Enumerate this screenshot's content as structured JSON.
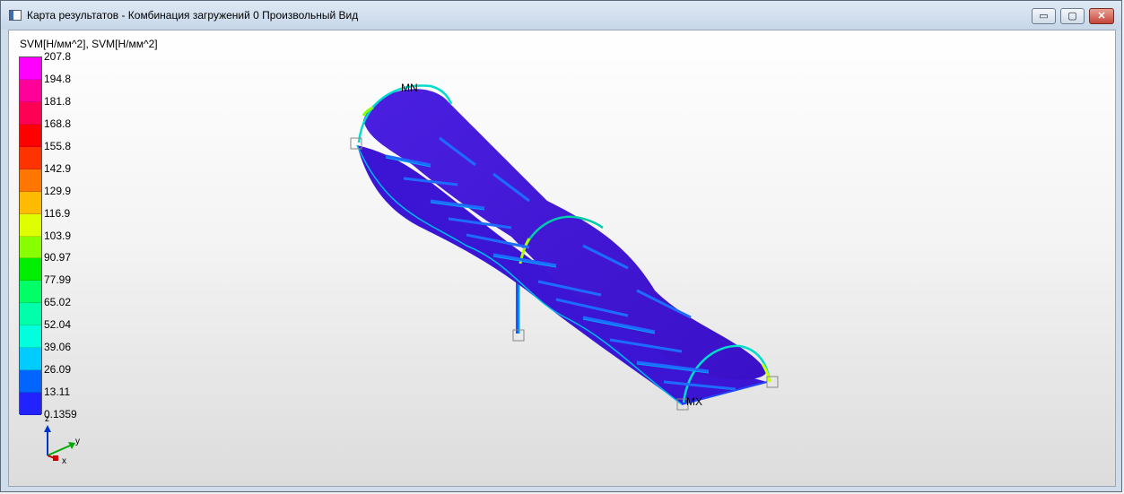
{
  "window": {
    "title": "Карта результатов - Комбинация загружений 0 Произвольный Вид",
    "controls": {
      "minimize": "▭",
      "maximize": "▢",
      "close": "✕"
    }
  },
  "legend": {
    "title": "SVM[Н/мм^2], SVM[Н/мм^2]",
    "values": [
      "207.8",
      "194.8",
      "181.8",
      "168.8",
      "155.8",
      "142.9",
      "129.9",
      "116.9",
      "103.9",
      "90.97",
      "77.99",
      "65.02",
      "52.04",
      "39.06",
      "26.09",
      "13.11",
      "0.1359"
    ],
    "colors": [
      "#ff00ff",
      "#ff0099",
      "#ff0055",
      "#ff0000",
      "#ff3300",
      "#ff7700",
      "#ffbb00",
      "#ddff00",
      "#88ff00",
      "#00ee00",
      "#00ff66",
      "#00ffaa",
      "#00ffdd",
      "#00ccff",
      "#0066ff",
      "#2222ff",
      "#3300cc"
    ]
  },
  "scene": {
    "label_mn": "MN",
    "label_mx": "MX",
    "support_icons": [
      "support-node-icon",
      "support-node-icon",
      "support-node-icon",
      "support-node-icon"
    ]
  },
  "axes": {
    "x": "x",
    "y": "y",
    "z": "z"
  }
}
